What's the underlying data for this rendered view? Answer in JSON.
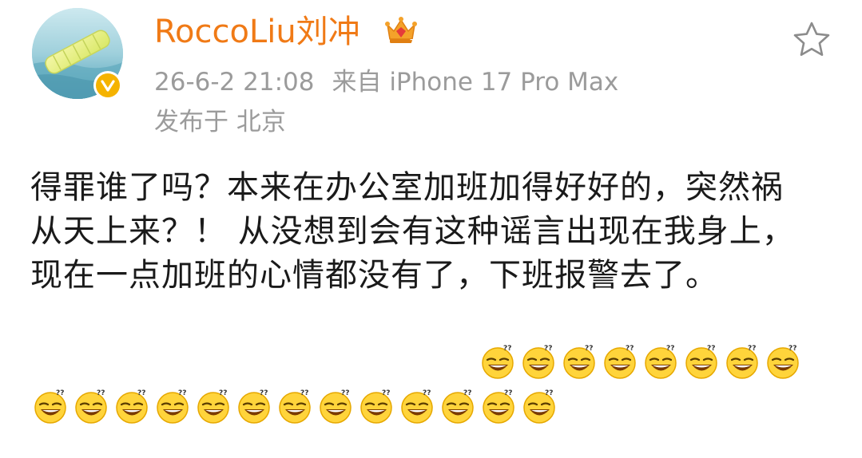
{
  "post": {
    "username": "RoccoLiu刘冲",
    "timestamp": "26-6-2 21:08",
    "source": "来自 iPhone 17 Pro Max",
    "location": "发布于 北京",
    "content": "得罪谁了吗？本来在办公室加班加得好好的，突然祸从天上来？！ 从没想到会有这种谣言出现在我身上，现在一点加班的心情都没有了，下班报警去了。",
    "emoji_name": "doge-sweat-emoji",
    "emoji_count_row1": 8,
    "emoji_count_row2": 13
  },
  "icons": {
    "avatar": "avatar-photo",
    "verified": "verified-badge-icon",
    "crown": "crown-icon",
    "favorite": "star-outline-icon"
  },
  "colors": {
    "username": "#f07a16",
    "meta": "#9b9b9b",
    "body": "#1a1a1a",
    "verified": "#f5b300"
  }
}
